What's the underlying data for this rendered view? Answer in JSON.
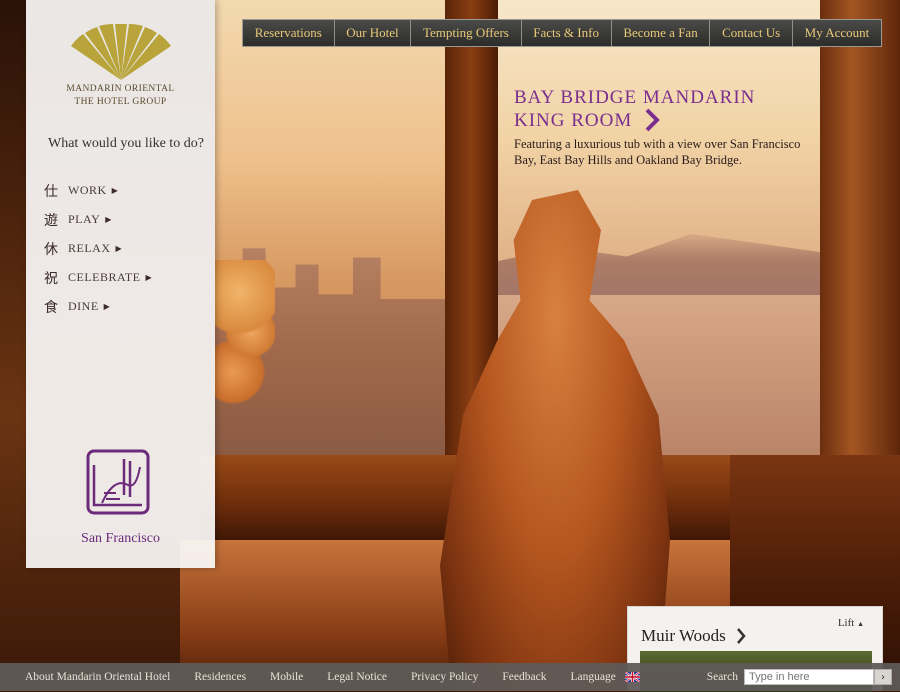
{
  "brand": {
    "line1": "MANDARIN ORIENTAL",
    "line2": "THE HOTEL GROUP",
    "gold_color": "#b8a43a"
  },
  "nav": {
    "items": [
      "Reservations",
      "Our Hotel",
      "Tempting Offers",
      "Facts & Info",
      "Become a Fan",
      "Contact Us",
      "My Account"
    ]
  },
  "sidebar": {
    "prompt": "What would you like to do?",
    "menu": [
      {
        "glyph": "仕",
        "label": "WORK"
      },
      {
        "glyph": "遊",
        "label": "PLAY"
      },
      {
        "glyph": "休",
        "label": "RELAX"
      },
      {
        "glyph": "祝",
        "label": "CELEBRATE"
      },
      {
        "glyph": "食",
        "label": "DINE"
      }
    ],
    "city": "San Francisco",
    "seal_icon": "san-francisco-seal-icon"
  },
  "promo": {
    "title_line1": "BAY BRIDGE MANDARIN",
    "title_line2": "KING ROOM",
    "description": "Featuring a luxurious tub with a view over San Francisco Bay, East Bay Hills and Oakland Bay Bridge.",
    "accent_color": "#7a2f8e"
  },
  "card": {
    "lift_label": "Lift",
    "title": "Muir Woods"
  },
  "footer": {
    "links": [
      "About Mandarin Oriental Hotel",
      "Residences",
      "Mobile",
      "Legal Notice",
      "Privacy Policy",
      "Feedback"
    ],
    "language_label": "Language",
    "search_label": "Search",
    "search_placeholder": "Type in here"
  }
}
